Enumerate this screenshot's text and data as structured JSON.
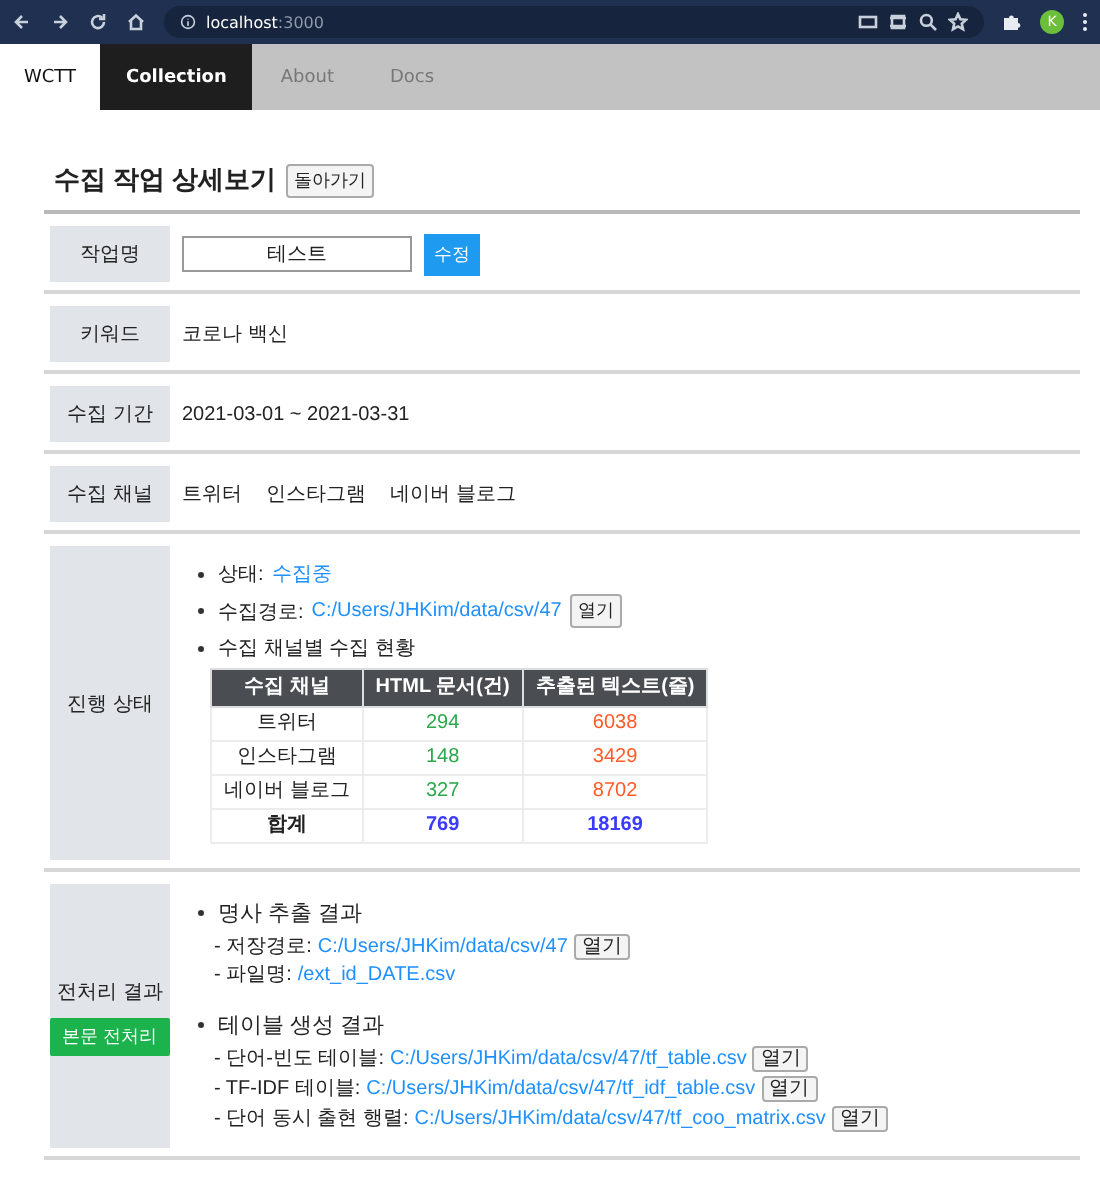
{
  "browser": {
    "host": "localhost",
    "port": ":3000",
    "avatar": "K"
  },
  "nav": {
    "brand": "WCTT",
    "tabs": [
      {
        "label": "Collection",
        "selected": true
      },
      {
        "label": "About",
        "selected": false
      },
      {
        "label": "Docs",
        "selected": false
      }
    ]
  },
  "page": {
    "title": "수집 작업 상세보기",
    "back_button": "돌아가기"
  },
  "job_name": {
    "label": "작업명",
    "value": "테스트",
    "button": "수정"
  },
  "keyword": {
    "label": "키워드",
    "value": "코로나 백신"
  },
  "period": {
    "label": "수집 기간",
    "value": "2021-03-01 ~ 2021-03-31"
  },
  "channels": {
    "label": "수집 채널",
    "items": [
      "트위터",
      "인스타그램",
      "네이버 블로그"
    ]
  },
  "progress": {
    "label": "진행 상태",
    "status_label": "상태:",
    "status": "수집중",
    "path_label": "수집경로:",
    "path": "C:/Users/JHKim/data/csv/47",
    "open_button": "열기",
    "table_title": "수집 채널별 수집 현황",
    "table": {
      "columns": [
        "수집 채널",
        "HTML 문서(건)",
        "추출된 텍스트(줄)"
      ],
      "rows": [
        {
          "kind": "data",
          "cells": [
            {
              "text": "트위터"
            },
            {
              "text": "294",
              "color": "#2ca84a"
            },
            {
              "text": "6038",
              "color": "#ff5a28"
            }
          ]
        },
        {
          "kind": "data",
          "cells": [
            {
              "text": "인스타그램"
            },
            {
              "text": "148",
              "color": "#2ca84a"
            },
            {
              "text": "3429",
              "color": "#ff5a28"
            }
          ]
        },
        {
          "kind": "data",
          "cells": [
            {
              "text": "네이버 블로그"
            },
            {
              "text": "327",
              "color": "#2ca84a"
            },
            {
              "text": "8702",
              "color": "#ff5a28"
            }
          ]
        },
        {
          "kind": "total",
          "cells": [
            {
              "text": "합계"
            },
            {
              "text": "769",
              "color": "#3b3bff"
            },
            {
              "text": "18169",
              "color": "#3b3bff"
            }
          ]
        }
      ]
    }
  },
  "preprocess": {
    "label": "전처리 결과",
    "button": "본문 전처리",
    "sections": [
      {
        "title": "명사 추출 결과",
        "items": [
          {
            "label": "- 저장경로:",
            "path": "C:/Users/JHKim/data/csv/47",
            "button": "열기"
          },
          {
            "label": "- 파일명:",
            "path": "/ext_id_DATE.csv"
          }
        ]
      },
      {
        "title": "테이블 생성 결과",
        "items": [
          {
            "label": "- 단어-빈도 테이블:",
            "path": "C:/Users/JHKim/data/csv/47/tf_table.csv",
            "button": "열기"
          },
          {
            "label": "- TF-IDF 테이블:",
            "path": "C:/Users/JHKim/data/csv/47/tf_idf_table.csv",
            "button": "열기"
          },
          {
            "label": "- 단어 동시 출현 행렬:",
            "path": "C:/Users/JHKim/data/csv/47/tf_coo_matrix.csv",
            "button": "열기"
          }
        ]
      }
    ]
  }
}
